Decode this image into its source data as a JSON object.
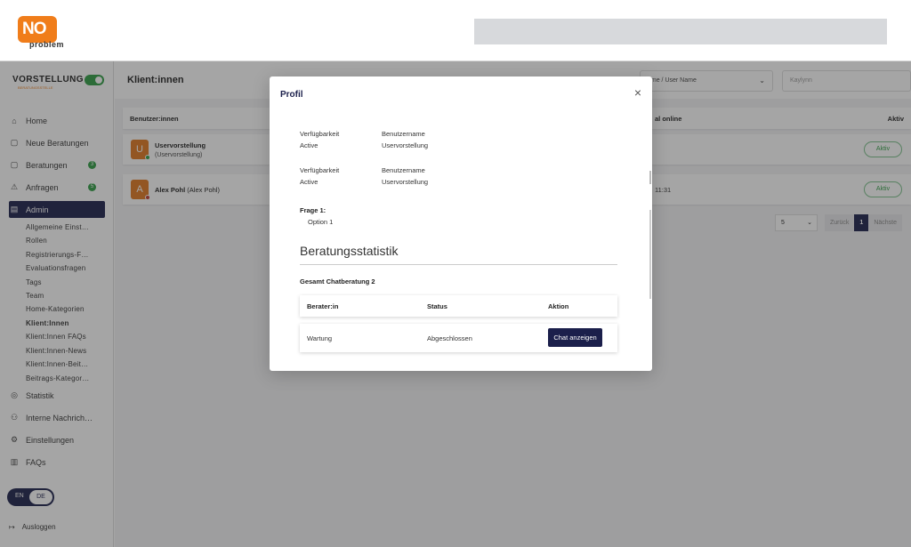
{
  "logo": {
    "mark": "NO",
    "sub": "problem"
  },
  "sidebar": {
    "brand": "VORSTELLUNG",
    "brand_sub": "BERATUNGSSTELLE",
    "items": [
      {
        "label": "Home",
        "icon": "home-icon"
      },
      {
        "label": "Neue Beratungen",
        "icon": "chat-icon"
      },
      {
        "label": "Beratungen",
        "icon": "chat-icon",
        "badge": "3"
      },
      {
        "label": "Anfragen",
        "icon": "alert-icon",
        "badge": "5"
      },
      {
        "label": "Admin",
        "icon": "admin-icon"
      }
    ],
    "sub_items": [
      "Allgemeine Einst…",
      "Rollen",
      "Registrierungs-F…",
      "Evaluationsfragen",
      "Tags",
      "Team",
      "Home-Kategorien",
      "Klient:Innen",
      "Klient:Innen FAQs",
      "Klient:Innen-News",
      "Klient:Innen-Beit…",
      "Beitrags-Kategor…"
    ],
    "bottom_items": [
      {
        "label": "Statistik",
        "icon": "chart-icon"
      },
      {
        "label": "Interne Nachrich…",
        "icon": "users-icon"
      },
      {
        "label": "Einstellungen",
        "icon": "gear-icon"
      },
      {
        "label": "FAQs",
        "icon": "book-icon"
      }
    ],
    "lang_en": "EN",
    "lang_de": "DE",
    "logout": "Ausloggen"
  },
  "main": {
    "title": "Klient:innen",
    "filter_select": "ame / User Name",
    "filter_input": "Kaylynn",
    "col_user": "Benutzer:innen",
    "col_online": "al online",
    "col_action": "Aktiv",
    "rows": [
      {
        "initial": "U",
        "name": "Uservorstellung",
        "sub": "(Uservorstellung)",
        "time": "",
        "action": "Aktiv"
      },
      {
        "initial": "A",
        "name": "Alex Pohl",
        "sub": "(Alex Pohl)",
        "time": "11:31",
        "action": "Aktiv"
      }
    ],
    "pager": {
      "size": "5",
      "prev": "Zurück",
      "page": "1",
      "next": "Nächste"
    }
  },
  "modal": {
    "title": "Profil",
    "blocks": [
      {
        "k1": "Verfügbarkeit",
        "v1": "Active",
        "k2": "Benutzername",
        "v2": "Uservorstellung"
      },
      {
        "k1": "Verfügbarkeit",
        "v1": "Active",
        "k2": "Benutzername",
        "v2": "Uservorstellung"
      }
    ],
    "question": "Frage 1:",
    "answer": "Option 1",
    "stats_title": "Beratungsstatistik",
    "stats_sub": "Gesamt Chatberatung 2",
    "table_headers": [
      "Berater:in",
      "Status",
      "Aktion"
    ],
    "table_row": {
      "berater": "Wartung",
      "status": "Abgeschlossen",
      "action": "Chat anzeigen"
    }
  },
  "colors": {
    "brand_orange": "#f07d1a",
    "navy": "#1b1f4b",
    "green": "#2f9e44"
  }
}
